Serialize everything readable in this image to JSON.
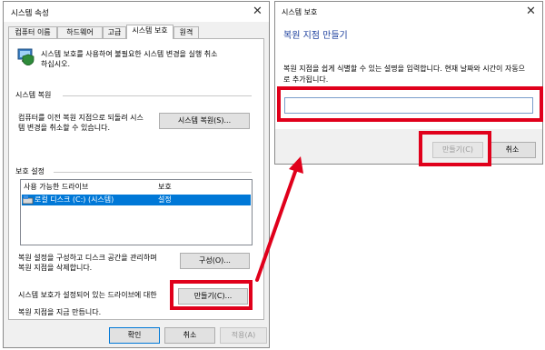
{
  "left_dialog": {
    "title": "시스템 속성",
    "tabs": [
      "컴퓨터 이름",
      "하드웨어",
      "고급",
      "시스템 보호",
      "원격"
    ],
    "intro_line1": "시스템 보호를 사용하여 불필요한 시스템 변경을 실행 취소",
    "intro_line2": "하십시오.",
    "restore_section": {
      "heading": "시스템 복원",
      "line1": "컴퓨터를 이전 복원 지점으로 되돌려 시스",
      "line2": "템 변경을 취소할 수 있습니다.",
      "button": "시스템 복원(S)..."
    },
    "protection_section": {
      "heading": "보호 설정",
      "col_drive": "사용 가능한 드라이브",
      "col_protection": "보호",
      "drives": [
        {
          "name": "로컬 디스크 (C:) (시스템)",
          "protection": "설정"
        }
      ],
      "configure_line1": "복원 설정을 구성하고 디스크 공간을 관리하며",
      "configure_line2": "복원 지점을 삭제합니다.",
      "configure_button": "구성(O)...",
      "create_line1": "시스템 보호가 설정되어 있는 드라이브에 대한",
      "create_line2": "복원 지점을 지금 만듭니다.",
      "create_button": "만들기(C)..."
    },
    "ok_button": "확인",
    "cancel_button": "취소",
    "apply_button": "적용(A)"
  },
  "right_dialog": {
    "title": "시스템 보호",
    "heading": "복원 지점 만들기",
    "desc_line1": "복원 지점을 쉽게 식별할 수 있는 설명을 입력합니다. 현재 날짜와 시간이 자동으",
    "desc_line2": "로 추가됩니다.",
    "input_value": "",
    "create_button": "만들기(C)",
    "cancel_button": "취소"
  },
  "colors": {
    "highlight_red": "#e0001b",
    "heading_blue": "#1a3d9c",
    "selection_blue": "#0078d7"
  }
}
